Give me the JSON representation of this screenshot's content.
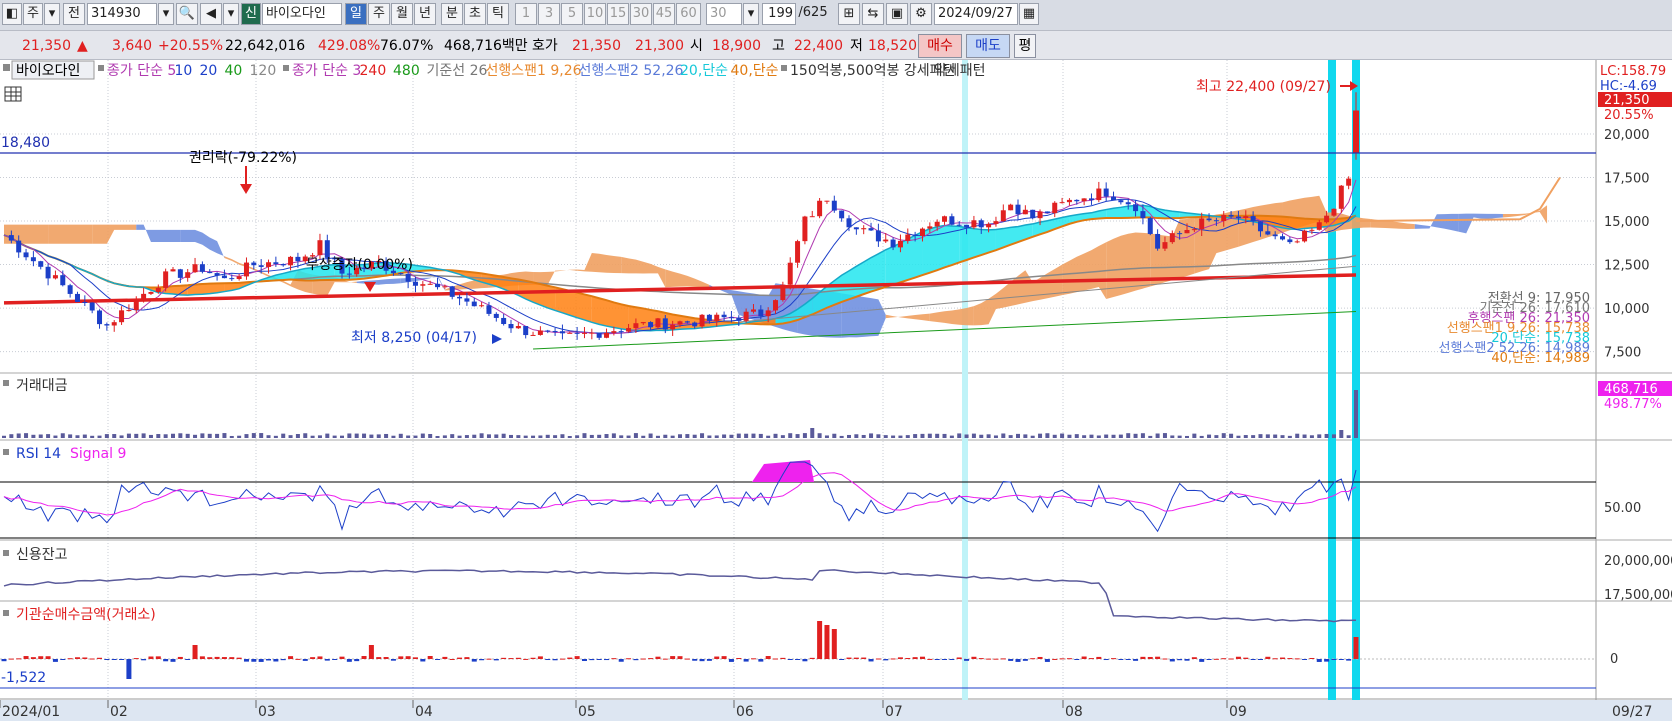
{
  "toolbar": {
    "market": "주",
    "prev_label": "전",
    "code": "314930",
    "stock_name": "바이오다인",
    "new_badge": "신",
    "periods": [
      "일",
      "주",
      "월",
      "년",
      "분",
      "초",
      "틱"
    ],
    "numbers": [
      "1",
      "3",
      "5",
      "10",
      "15",
      "30",
      "45",
      "60"
    ],
    "interval_value": "30",
    "count": "199",
    "count_total": "/625",
    "date": "2024/09/27",
    "icons": [
      "chart-type-icon",
      "search-icon",
      "speaker-icon",
      "layout-icon",
      "compare-icon",
      "save-icon",
      "gear-icon",
      "calendar-icon"
    ]
  },
  "quote": {
    "price": "21,350",
    "change": "3,640",
    "change_pct": "+20.55%",
    "volume": "22,642,016",
    "vol_ratio": "429.08%",
    "turnover_ratio": "76.07%",
    "amount": "468,716백만",
    "bid_label": "호가",
    "ask": "21,350",
    "bid": "21,300",
    "open_label": "시",
    "open": "18,900",
    "high_label": "고",
    "high": "22,400",
    "low_label": "저",
    "low": "18,520",
    "buy_label": "매수",
    "sell_label": "매도",
    "eval_label": "평",
    "up_color": "#e02020",
    "down_color": "#1c3fc8"
  },
  "legend": {
    "name": "바이오다인",
    "items": [
      {
        "text": "종가 단순 5",
        "color": "#b03ab0"
      },
      {
        "text": "10",
        "color": "#1c3fc8"
      },
      {
        "text": "20",
        "color": "#1c3fc8"
      },
      {
        "text": "40",
        "color": "#1a9a1a"
      },
      {
        "text": "120",
        "color": "#888888"
      },
      {
        "text": "종가 단순 3",
        "color": "#b03ab0"
      },
      {
        "text": "240",
        "color": "#e02020"
      },
      {
        "text": "480",
        "color": "#1a9a1a"
      },
      {
        "text": "기준선 26",
        "color": "#777777"
      },
      {
        "text": "선행스팬1 9,26",
        "color": "#e88a30"
      },
      {
        "text": "선행스팬2 52,26",
        "color": "#5a7ad8"
      },
      {
        "text": "20,단순",
        "color": "#16c8d8"
      },
      {
        "text": "40,단순",
        "color": "#e07a10"
      },
      {
        "text": "150억봉,500억봉 강세패턴",
        "color": "#333333"
      },
      {
        "text": "약세패턴",
        "color": "#333333"
      }
    ]
  },
  "annotations": {
    "hline": "18,480",
    "rights_drop": "권리락(-79.22%)",
    "capital_increase": "무상증자(0.00%)",
    "low_mark": "최저 8,250 (04/17)",
    "high_mark": "최고 22,400 (09/27)",
    "lc": "LC:158.79",
    "hc": "HC:-4.69",
    "last_price": "21,350",
    "last_pct": "20.55%"
  },
  "right_labels": [
    {
      "text": "전환선 9: 17,950",
      "color": "#666666"
    },
    {
      "text": "기준선 26: 17,610",
      "color": "#777777"
    },
    {
      "text": "후행스팬 26: 21,350",
      "color": "#b03ab0"
    },
    {
      "text": "선행스팬1 9,26: 15,738",
      "color": "#e88a30"
    },
    {
      "text": "20,단순: 15,738",
      "color": "#16c8d8"
    },
    {
      "text": "선행스팬2 52,26: 14,989",
      "color": "#5a7ad8"
    },
    {
      "text": "40,단순: 14,989",
      "color": "#e07a10"
    }
  ],
  "panels": {
    "amount_title": "거래대금",
    "amount_value": "468,716",
    "amount_pct": "498.77%",
    "rsi_title": "RSI 14",
    "rsi_signal": "Signal 9",
    "rsi_tick": "50.00",
    "credit_title": "신용잔고",
    "credit_ticks": [
      "20,000,000",
      "17,500,000"
    ],
    "inst_title": "기관순매수금액(거래소)",
    "inst_value": "-1,522",
    "inst_tick": "0"
  },
  "chart_data": {
    "type": "candlestick",
    "y_ticks": [
      "20,000",
      "17,500",
      "15,000",
      "12,500",
      "10,000",
      "7,500"
    ],
    "ylim": [
      6500,
      23500
    ],
    "x_labels": [
      "2024/01",
      "02",
      "03",
      "04",
      "05",
      "06",
      "07",
      "08",
      "09"
    ],
    "current_date": "09/27",
    "n": 185,
    "events": [
      {
        "i": 43,
        "label": "권리락(-79.22%)"
      },
      {
        "i": 63,
        "label": "무상증자(0.00%)"
      }
    ],
    "anchors": [
      {
        "i": 0,
        "p": 14200
      },
      {
        "i": 6,
        "p": 12000
      },
      {
        "i": 14,
        "p": 9000
      },
      {
        "i": 18,
        "p": 10500
      },
      {
        "i": 22,
        "p": 11800
      },
      {
        "i": 27,
        "p": 12300
      },
      {
        "i": 30,
        "p": 11600
      },
      {
        "i": 34,
        "p": 12500
      },
      {
        "i": 40,
        "p": 12800
      },
      {
        "i": 43,
        "p": 13600
      },
      {
        "i": 46,
        "p": 12000
      },
      {
        "i": 51,
        "p": 12600
      },
      {
        "i": 56,
        "p": 11600
      },
      {
        "i": 62,
        "p": 10600
      },
      {
        "i": 70,
        "p": 8800
      },
      {
        "i": 76,
        "p": 8250
      },
      {
        "i": 86,
        "p": 9000
      },
      {
        "i": 96,
        "p": 9300
      },
      {
        "i": 103,
        "p": 9700
      },
      {
        "i": 106,
        "p": 11200
      },
      {
        "i": 109,
        "p": 15000
      },
      {
        "i": 112,
        "p": 16400
      },
      {
        "i": 116,
        "p": 14500
      },
      {
        "i": 121,
        "p": 13800
      },
      {
        "i": 127,
        "p": 15100
      },
      {
        "i": 134,
        "p": 14900
      },
      {
        "i": 137,
        "p": 16000
      },
      {
        "i": 140,
        "p": 15200
      },
      {
        "i": 146,
        "p": 16300
      },
      {
        "i": 150,
        "p": 16700
      },
      {
        "i": 154,
        "p": 15900
      },
      {
        "i": 157,
        "p": 13500
      },
      {
        "i": 162,
        "p": 14800
      },
      {
        "i": 168,
        "p": 15200
      },
      {
        "i": 175,
        "p": 13500
      },
      {
        "i": 179,
        "p": 14700
      },
      {
        "i": 181,
        "p": 16000
      },
      {
        "i": 183,
        "p": 17400
      },
      {
        "i": 184,
        "p": 21350
      }
    ],
    "last_candle": {
      "open": 18900,
      "high": 22400,
      "low": 18520,
      "close": 21350
    }
  }
}
